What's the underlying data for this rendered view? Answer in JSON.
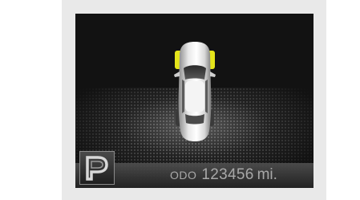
{
  "odometer": {
    "label": "ODO",
    "value": "123456",
    "unit": "mi."
  },
  "gear_indicator": {
    "icon": "parking-brake-icon"
  },
  "vehicle": {
    "icon": "car-top-view-icon",
    "highlighted_tires": [
      "front-left",
      "front-right"
    ]
  },
  "colors": {
    "highlight": "#e5e51a",
    "screen_background": "#121212",
    "text": "#a8a8a8"
  }
}
